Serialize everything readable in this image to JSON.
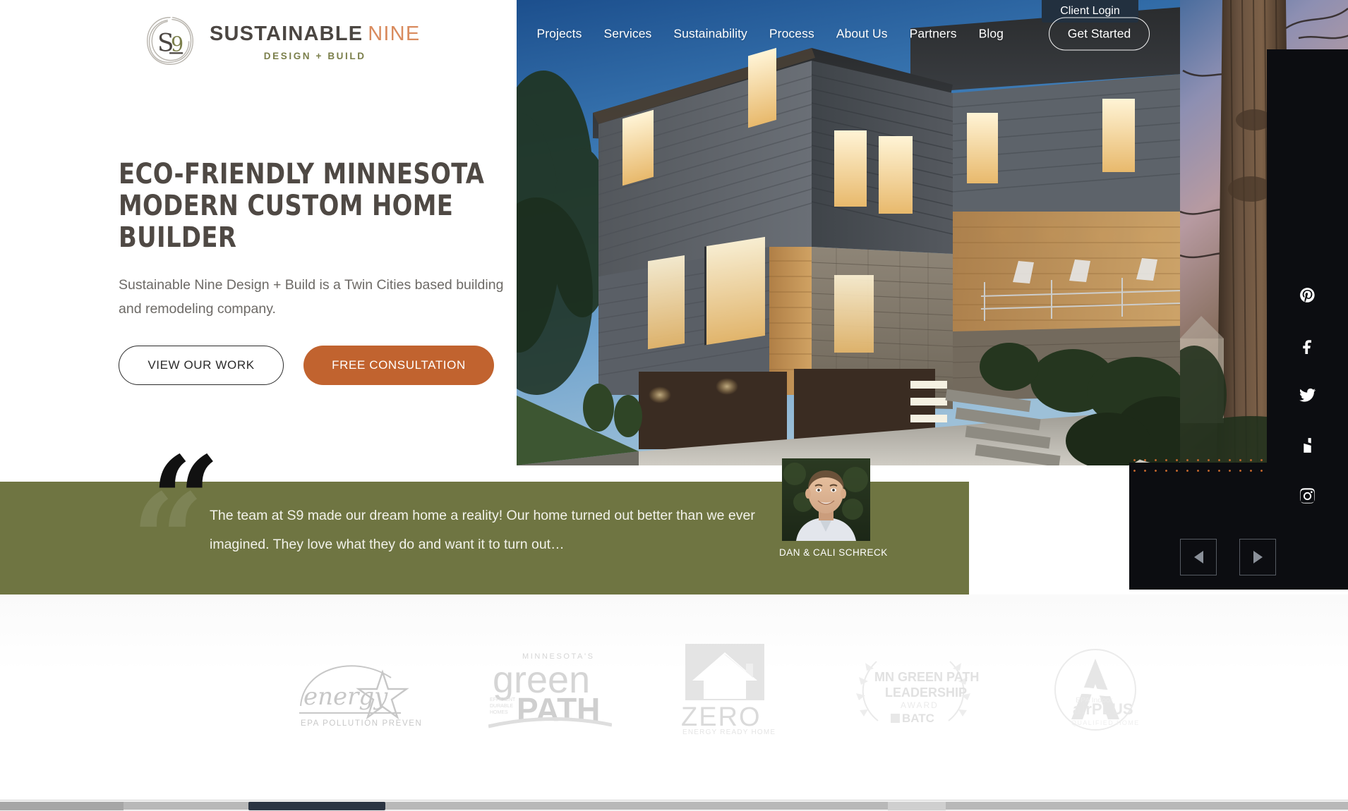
{
  "brand": {
    "mark": "S9",
    "name_part1": "SUSTAINABLE",
    "name_part2": "NINE",
    "tagline": "DESIGN + BUILD",
    "accent_orange": "#d98b5e",
    "accent_olive": "#7b7f4b",
    "dark": "#4b4642"
  },
  "nav": {
    "client_login": "Client Login",
    "items": [
      {
        "label": "Projects"
      },
      {
        "label": "Services"
      },
      {
        "label": "Sustainability"
      },
      {
        "label": "Process"
      },
      {
        "label": "About Us"
      },
      {
        "label": "Partners"
      },
      {
        "label": "Blog"
      }
    ],
    "cta": "Get Started"
  },
  "hero": {
    "title": "ECO-FRIENDLY MINNESOTA MODERN CUSTOM HOME BUILDER",
    "subtitle": "Sustainable Nine Design + Build is a Twin Cities based building and remodeling company.",
    "primary_button": "VIEW OUR WORK",
    "secondary_button": "FREE CONSULTATION",
    "button_fill_color": "#c1632f",
    "image_alt": "Modern two-story custom home at dusk with lit windows, gray siding, wood soffits and stone facade"
  },
  "testimonial": {
    "quote_glyph": "“",
    "text": "The team at S9 made our dream home a reality! Our home turned out better than we ever imagined. They love what they do and want it to turn out…",
    "author": "DAN & CALI SCHRECK",
    "band_color": "#6f7542"
  },
  "badges": [
    {
      "name": "energy-star",
      "line1": "energy",
      "line2": "EPA  POLLUTION  PREVENTER"
    },
    {
      "name": "mn-green-path",
      "line1": "MINNESOTA'S",
      "line2": "green",
      "line3": "PATH"
    },
    {
      "name": "zero-energy-ready-home",
      "line1": "ZERO",
      "line2": "ENERGY READY HOME"
    },
    {
      "name": "mn-green-path-leadership",
      "line1": "MN GREEN PATH",
      "line2": "LEADERSHIP",
      "line3": "AWARD",
      "line4": "BATC"
    },
    {
      "name": "epa-indoor-airplus",
      "line1": "EPA Indoor",
      "line2": "airPLUS",
      "line3": "QUALIFIED HOMES"
    }
  ],
  "social": [
    {
      "name": "pinterest"
    },
    {
      "name": "facebook"
    },
    {
      "name": "twitter"
    },
    {
      "name": "houzz"
    },
    {
      "name": "instagram"
    }
  ],
  "carousel": {
    "prev_label": "◀",
    "next_label": "▶"
  }
}
